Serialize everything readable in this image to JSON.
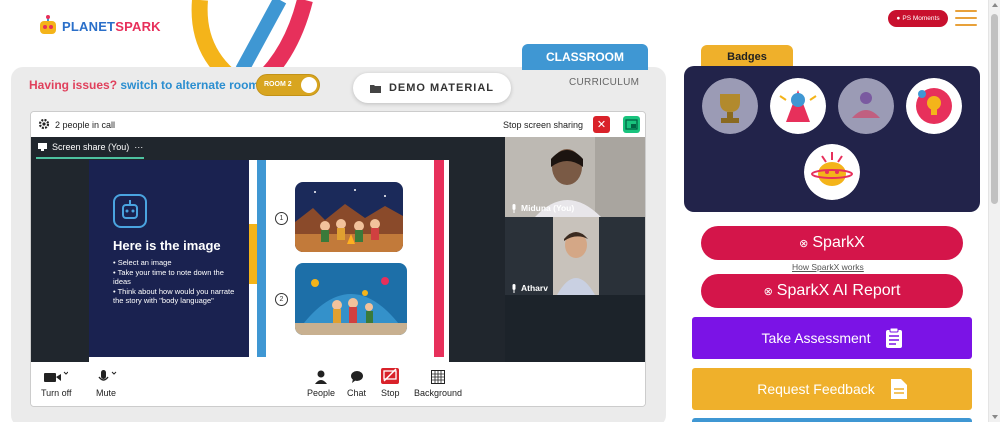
{
  "brand": {
    "logo_text_a": "PLANET",
    "logo_text_b": "SPARK"
  },
  "header": {
    "ps_moments": "PS Moments"
  },
  "tabs": {
    "classroom": "CLASSROOM",
    "curriculum": "CURRICULUM"
  },
  "issue": {
    "question": "Having issues?",
    "link": "switch to alternate room",
    "room_label": "ROOM 2"
  },
  "demo_material": "DEMO MATERIAL",
  "call": {
    "people_count": "2 people in call",
    "stop_sharing": "Stop screen sharing",
    "screen_share_label": "Screen share (You)",
    "participants": [
      {
        "name": "Miduna (You)"
      },
      {
        "name": "Atharv"
      }
    ],
    "controls": {
      "turn_off": "Turn off",
      "mute": "Mute",
      "people": "People",
      "chat": "Chat",
      "stop": "Stop",
      "background": "Background"
    }
  },
  "slide": {
    "title": "Here is the image",
    "bullets": [
      "• Select an image",
      "• Take your time to note down the ideas",
      "• Think about how would you narrate the story with \"body language\""
    ],
    "options": [
      "1",
      "2"
    ]
  },
  "badges": {
    "title": "Badges"
  },
  "sparkx": {
    "label": "SparkX",
    "how_link": "How SparkX works",
    "ai_report": "SparkX AI Report"
  },
  "actions": {
    "take_assessment": "Take Assessment",
    "request_feedback": "Request Feedback"
  },
  "colors": {
    "brand_red": "#d4154a",
    "brand_blue": "#3f97d3",
    "purple": "#7b13e6",
    "orange": "#efb02b",
    "navy": "#22234a"
  }
}
